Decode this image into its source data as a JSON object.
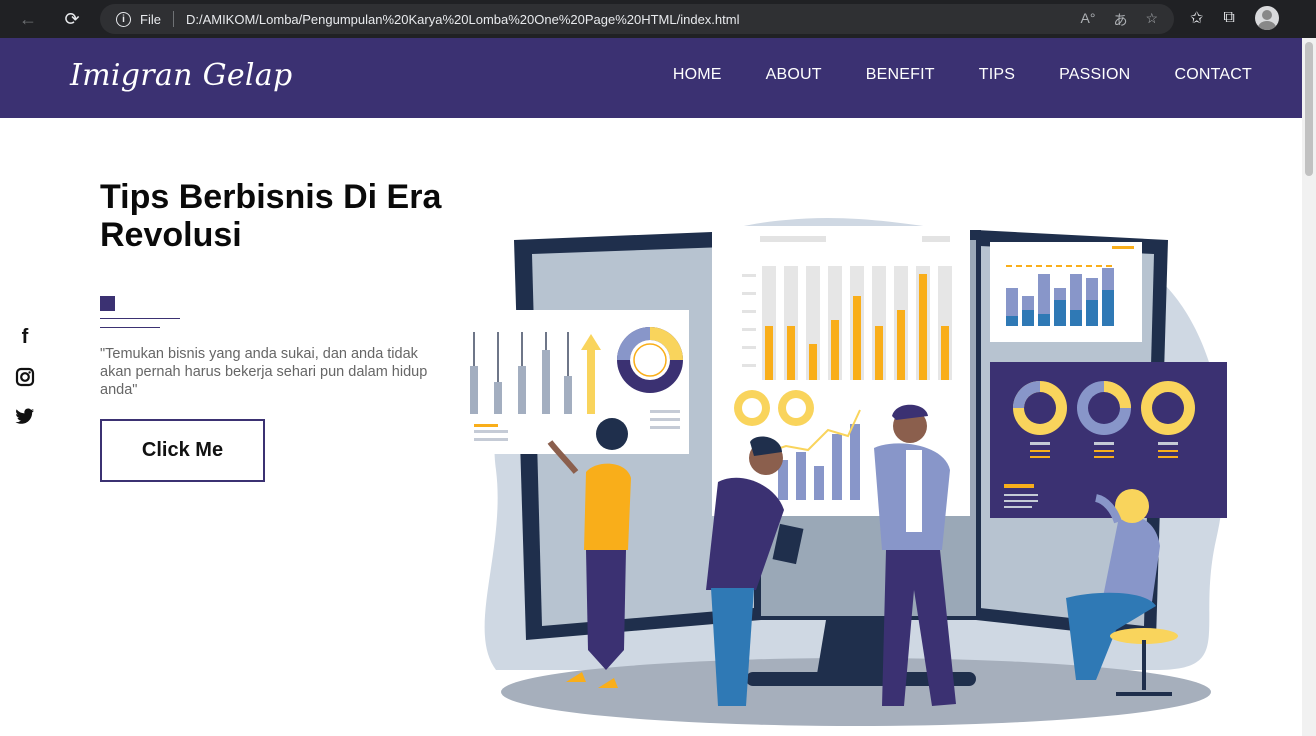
{
  "browser": {
    "address": {
      "scheme": "File",
      "url": "D:/AMIKOM/Lomba/Pengumpulan%20Karya%20Lomba%20One%20Page%20HTML/index.html"
    }
  },
  "header": {
    "brand": "Imigran Gelap",
    "nav": [
      {
        "label": "HOME"
      },
      {
        "label": "ABOUT"
      },
      {
        "label": "BENEFIT"
      },
      {
        "label": "TIPS"
      },
      {
        "label": "PASSION"
      },
      {
        "label": "CONTACT"
      }
    ]
  },
  "hero": {
    "title": "Tips Berbisnis Di Era Revolusi",
    "quote": "\"Temukan bisnis yang anda sukai, dan anda tidak akan pernah harus bekerja sehari pun dalam hidup anda\"",
    "cta_label": "Click Me"
  },
  "social": [
    {
      "icon": "facebook-icon",
      "glyph": "f"
    },
    {
      "icon": "instagram-icon",
      "glyph": "◎"
    },
    {
      "icon": "twitter-icon",
      "glyph": "🐦"
    }
  ],
  "colors": {
    "brand_purple": "#3b3172",
    "accent_yellow": "#f9ae1a",
    "chart_blue": "#2f79b5",
    "lavender": "#8896c9"
  }
}
